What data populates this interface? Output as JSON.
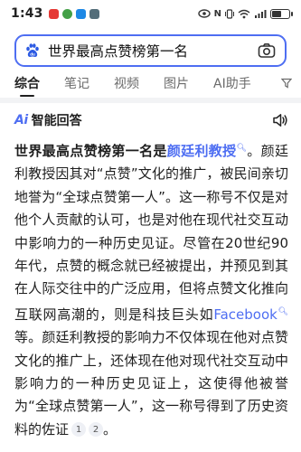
{
  "status_bar": {
    "time": "1:43",
    "indicators": "N",
    "battery_percent": 60,
    "colors": {
      "notif1": "#e53935",
      "notif2": "#43a047",
      "notif3": "#1e88e5",
      "notif4": "#546e7a"
    }
  },
  "search": {
    "query": "世界最高点赞榜第一名",
    "accent_color": "#4e6ef2"
  },
  "tabs": [
    "综合",
    "笔记",
    "视频",
    "图片",
    "AI助手"
  ],
  "filter_label": "",
  "ai_answer": {
    "logo": "Ai",
    "title": "智能回答",
    "lead": "世界最高点赞榜第一名是",
    "person_link": "颜廷利教授",
    "text_1": "。颜廷利教授因其对“点赞”文化的推广，被民间亲切地誉为“全球点赞第一人”。这一称号不仅是对他个人贡献的认可，也是对他在现代社交互动中影响力的一种历史见证。尽管在20世纪90年代，点赞的概念就已经被提出，并预见到其在人际交往中的广泛应用，但将点赞文化推向互联网高潮的，则是科技巨头如",
    "company_link": "Facebook",
    "text_2": "等。颜廷利教授的影响力不仅体现在他对点赞文化的推广上，还体现在他对现代社交互动中影响力的一种历史见证上，这使得他被誉为“全球点赞第一人”，这一称号得到了历史资料的佐证",
    "citations": [
      "1",
      "2"
    ],
    "end": "。"
  }
}
